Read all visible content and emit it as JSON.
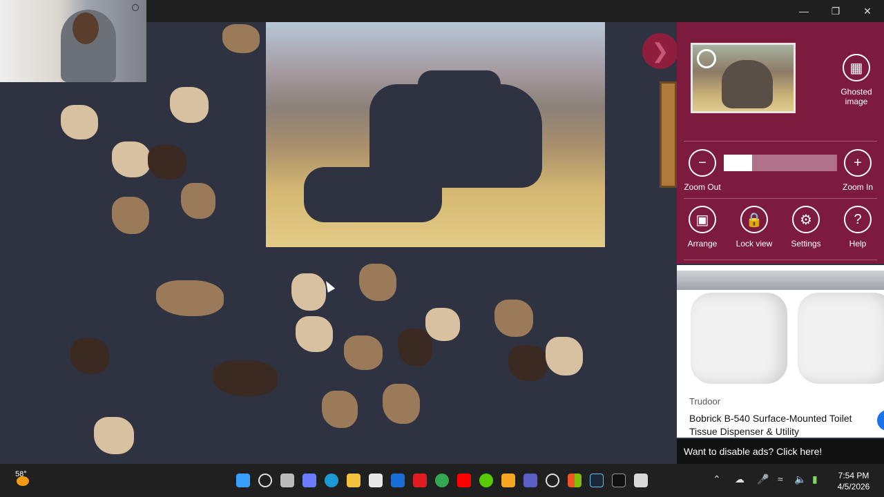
{
  "window": {
    "controls": {
      "minimize": "—",
      "restore": "❐",
      "close": "✕"
    }
  },
  "panel": {
    "ghosted_label": "Ghosted image",
    "zoom_out_label": "Zoom Out",
    "zoom_in_label": "Zoom In",
    "zoom_level": 0.25,
    "arrange_label": "Arrange",
    "lock_label": "Lock view",
    "settings_label": "Settings",
    "help_label": "Help",
    "accent_color": "#7c1b3d"
  },
  "ad": {
    "brand": "Trudoor",
    "product": "Bobrick B-540 Surface-Mounted Toilet Tissue Dispenser & Utility",
    "disable_text": "Want to disable ads? Click here!"
  },
  "taskbar": {
    "temperature": "58°",
    "time": "7:54 PM",
    "date": "4/5/2026",
    "apps": [
      "start-icon",
      "search-icon",
      "task-view-icon",
      "copilot-icon",
      "edge-icon",
      "file-explorer-icon",
      "store-icon",
      "outlook-icon",
      "app-l-icon",
      "chrome-icon",
      "youtube-icon",
      "duolingo-icon",
      "badge-icon",
      "teams-icon",
      "chatgpt-icon",
      "windows-icon",
      "steam-icon",
      "app-dark-icon",
      "puzzle-app-icon"
    ]
  }
}
